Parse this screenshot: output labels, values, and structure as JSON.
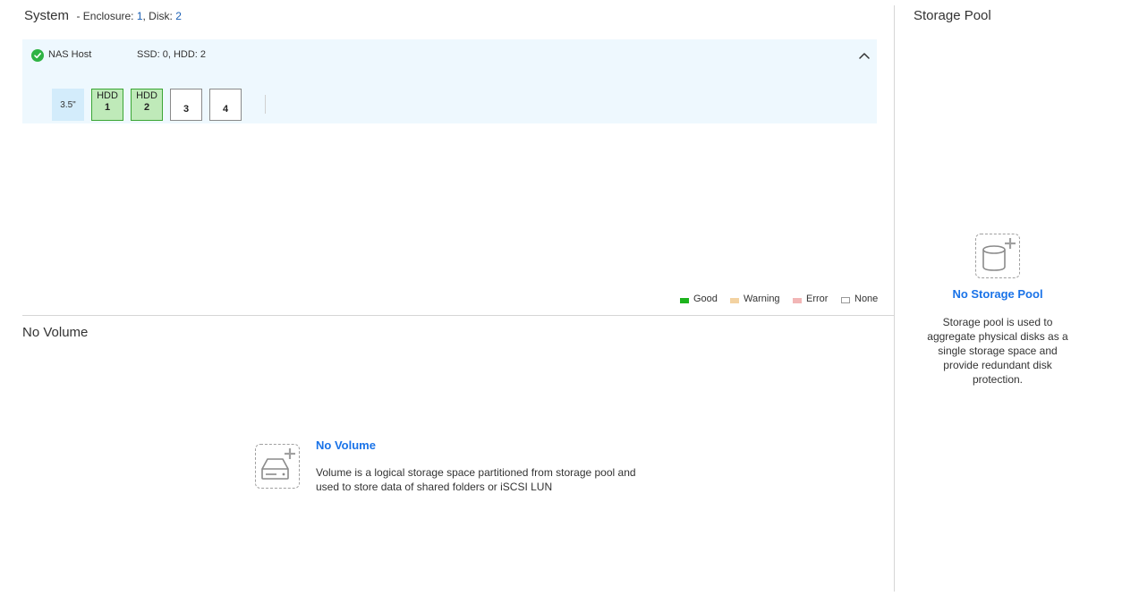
{
  "system": {
    "title": "System",
    "meta_prefix": "- Enclosure: ",
    "enclosure_count": "1",
    "disk_label": ", Disk: ",
    "disk_count": "2"
  },
  "enclosure": {
    "name": "NAS Host",
    "status": "good",
    "summary": "SSD: 0, HDD: 2",
    "slot_size": "3.5\"",
    "slots": [
      {
        "type": "HDD",
        "number": "1",
        "state": "good"
      },
      {
        "type": "HDD",
        "number": "2",
        "state": "good"
      },
      {
        "type": "",
        "number": "3",
        "state": "none"
      },
      {
        "type": "",
        "number": "4",
        "state": "none"
      }
    ]
  },
  "legend": [
    {
      "label": "Good",
      "color": "#1db31d"
    },
    {
      "label": "Warning",
      "color": "#f3d2a1"
    },
    {
      "label": "Error",
      "color": "#f2b6b6"
    },
    {
      "label": "None",
      "color": "#ffffff"
    }
  ],
  "volume": {
    "section_title": "No Volume",
    "empty_title": "No Volume",
    "empty_description": "Volume is a logical storage space partitioned from storage pool and used to store data of shared folders or iSCSI LUN",
    "icon": "add-volume-icon"
  },
  "storage_pool": {
    "section_title": "Storage Pool",
    "empty_title": "No Storage Pool",
    "empty_description": "Storage pool is used to aggregate physical disks as a single storage space and provide redundant disk protection.",
    "icon": "add-storage-pool-icon"
  },
  "colors": {
    "accent": "#1a73e8",
    "good": "#2fb344",
    "enclosure_bg": "#eef8fe"
  }
}
